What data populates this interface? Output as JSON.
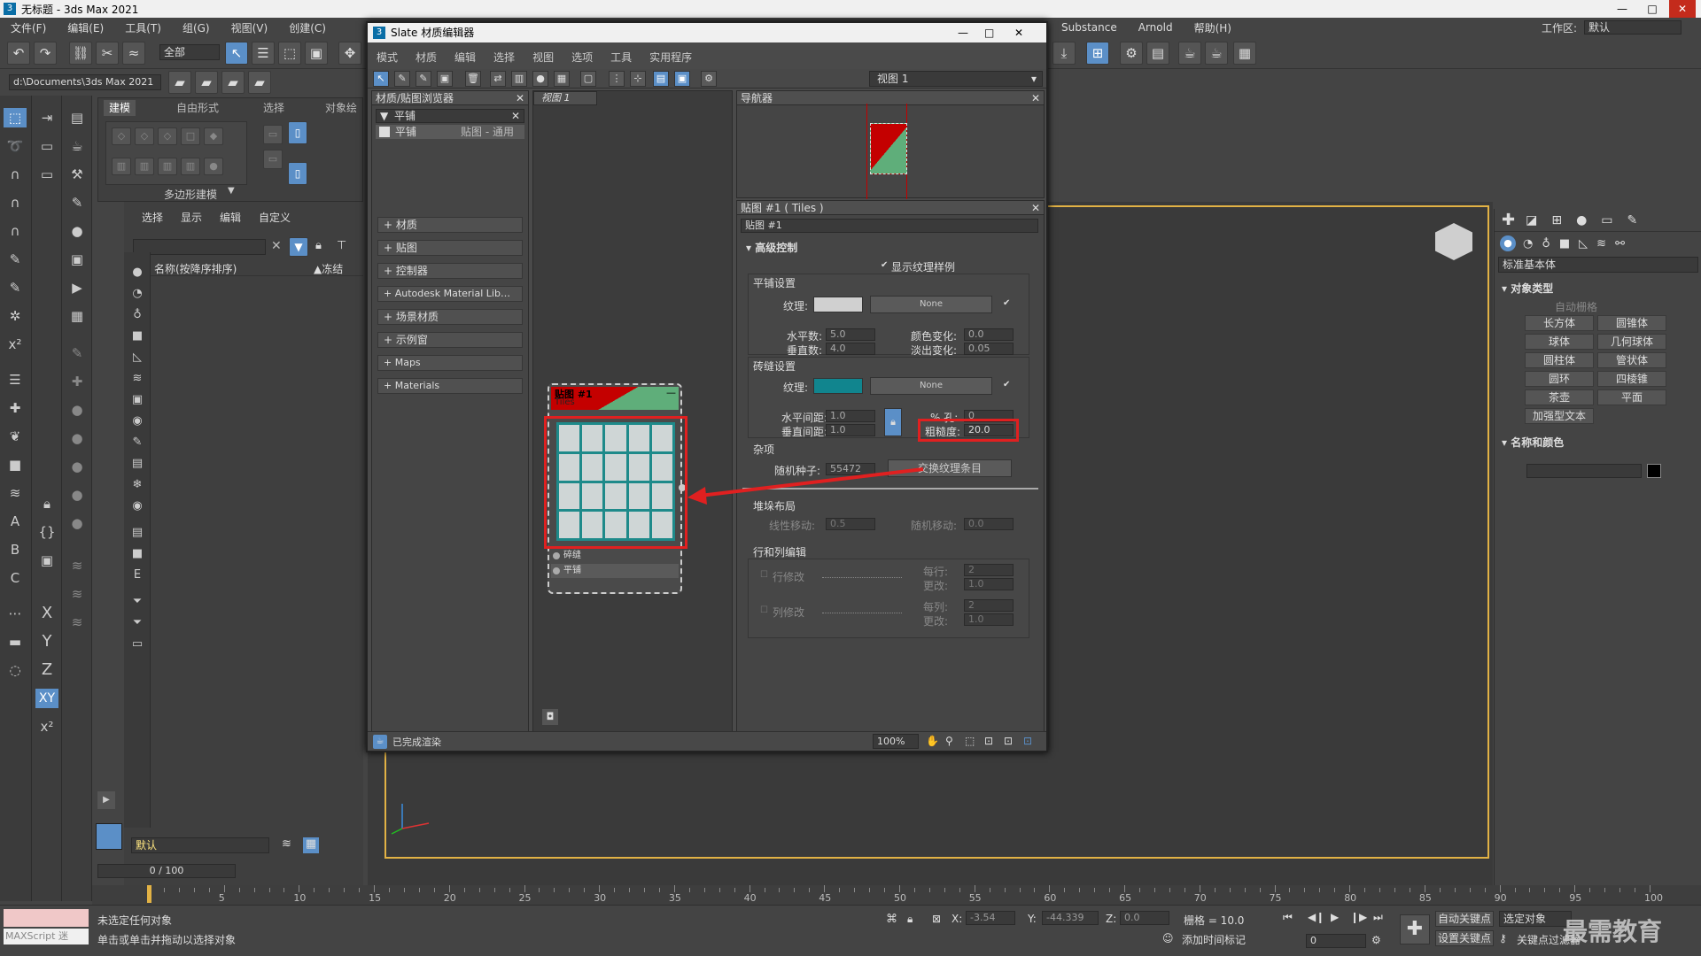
{
  "window": {
    "title": "无标题 - 3ds Max 2021"
  },
  "menubar": {
    "items": [
      "文件(F)",
      "编辑(E)",
      "工具(T)",
      "组(G)",
      "视图(V)",
      "创建(C)"
    ],
    "right_items": [
      "Substance",
      "Arnold",
      "帮助(H)"
    ],
    "workspace_label": "工作区:",
    "workspace_value": "默认"
  },
  "toolbar": {
    "selection_filter": "全部",
    "path": "d:\\Documents\\3ds Max 2021"
  },
  "ribbon": {
    "tabs": [
      "建模",
      "自由形式",
      "选择",
      "对象绘"
    ],
    "group_label": "多边形建模"
  },
  "scene_explorer": {
    "menu": [
      "选择",
      "显示",
      "编辑",
      "自定义"
    ],
    "column_name": "名称(按降序排序)",
    "column_frozen": "▲冻结"
  },
  "slate": {
    "title": "Slate 材质编辑器",
    "menu": [
      "模式",
      "材质",
      "编辑",
      "选择",
      "视图",
      "选项",
      "工具",
      "实用程序"
    ],
    "view_dropdown": "视图 1",
    "browser": {
      "title": "材质/贴图浏览器",
      "search_header": "平铺",
      "result_name": "平铺",
      "result_type": "贴图 - 通用",
      "categories": [
        "+ 材质",
        "+ 贴图",
        "+ 控制器",
        "+ Autodesk Material Lib…",
        "+ 场景材质",
        "+ 示例窗",
        "+ Maps",
        "+ Materials"
      ]
    },
    "view_tab": "视图 1",
    "node": {
      "title": "贴图 #1",
      "subtitle": "Tiles",
      "slot1": "碎缝",
      "slot2": "平铺"
    },
    "navigator": {
      "title": "导航器"
    },
    "params": {
      "header": "贴图 #1  ( Tiles )",
      "name_field": "贴图 #1",
      "rollout_advanced": "高级控制",
      "show_texture_swatches": "显示纹理样例",
      "tiles_setup": "平铺设置",
      "texture_label": "纹理:",
      "none_label": "None",
      "horiz_count_label": "水平数:",
      "horiz_count": "5.0",
      "vert_count_label": "垂直数:",
      "vert_count": "4.0",
      "color_variance_label": "颜色变化:",
      "color_variance": "0.0",
      "fade_variance_label": "淡出变化:",
      "fade_variance": "0.05",
      "grout_setup": "砖缝设置",
      "grout_none_label": "None",
      "h_gap_label": "水平间距:",
      "h_gap": "1.0",
      "v_gap_label": "垂直间距:",
      "v_gap": "1.0",
      "holes_label": "% 孔:",
      "holes": "0",
      "rough_label": "粗糙度:",
      "rough": "20.0",
      "misc": "杂项",
      "seed_label": "随机种子:",
      "seed": "55472",
      "swap_button": "交换纹理条目",
      "stacking_layout": "堆垛布局",
      "line_shift_label": "线性移动:",
      "line_shift": "0.5",
      "random_shift_label": "随机移动:",
      "random_shift": "0.0",
      "row_col_edit": "行和列编辑",
      "row_modify": "行修改",
      "per_row_label": "每行:",
      "per_row": "2",
      "change_label": "更改:",
      "row_change": "1.0",
      "col_modify": "列修改",
      "per_col_label": "每列:",
      "per_col": "2",
      "col_change": "1.0"
    },
    "status": "已完成渲染",
    "zoom": "100%"
  },
  "command_panel": {
    "dropdown": "标准基本体",
    "object_type": "对象类型",
    "autogrid": "自动栅格",
    "buttons": [
      "长方体",
      "圆锥体",
      "球体",
      "几何球体",
      "圆柱体",
      "管状体",
      "圆环",
      "四棱锥",
      "茶壶",
      "平面",
      "加强型文本"
    ],
    "name_color": "名称和颜色"
  },
  "layer": {
    "name": "默认"
  },
  "timeline": {
    "frame": "0 / 100",
    "ticks": [
      "5",
      "10",
      "15",
      "20",
      "25",
      "30",
      "35",
      "40",
      "45",
      "50",
      "55",
      "60",
      "65",
      "70",
      "75",
      "80",
      "85",
      "90",
      "95",
      "100"
    ]
  },
  "status": {
    "maxscript": "MAXScript 迷",
    "line1": "未选定任何对象",
    "line2": "单击或单击并拖动以选择对象",
    "x_label": "X:",
    "x": "-3.54",
    "y_label": "Y:",
    "y": "-44.339",
    "z_label": "Z:",
    "z": "0.0",
    "grid": "栅格 = 10.0",
    "add_time_tag": "添加时间标记",
    "auto_key": "自动关键点",
    "set_key": "设置关键点",
    "selected": "选定对象",
    "key_filters": "关键点过滤器",
    "frame_field": "0",
    "watermark": "最需教育"
  },
  "colors": {
    "highlight": "#e02020",
    "accent": "#5b8fc7",
    "grout": "#1e8a8a",
    "viewport_frame": "#e2b245"
  }
}
